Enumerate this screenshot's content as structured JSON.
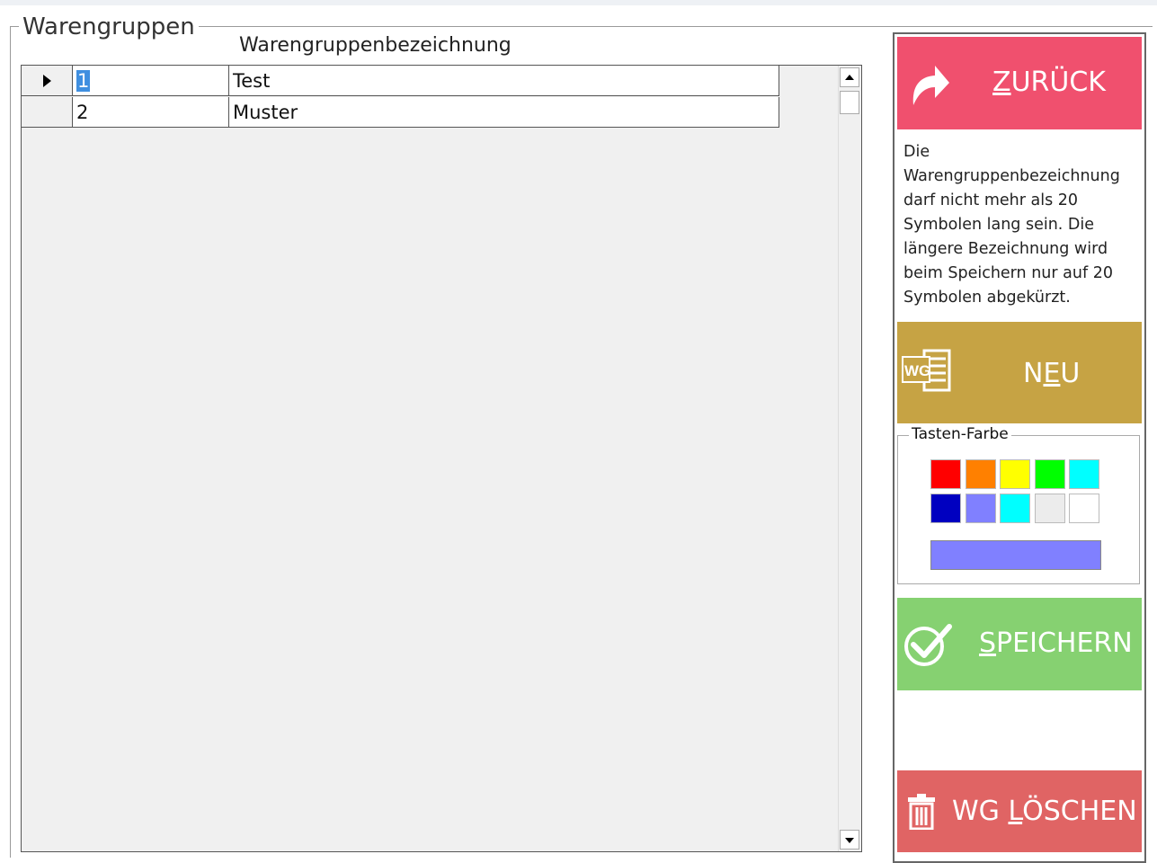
{
  "group_title": "Warengruppen",
  "grid": {
    "column_header": "Warengruppenbezeichnung",
    "rows": [
      {
        "id": "1",
        "name": "Test",
        "current": true
      },
      {
        "id": "2",
        "name": "Muster",
        "current": false
      }
    ]
  },
  "buttons": {
    "back": {
      "prefix": "",
      "underline": "Z",
      "rest": "URÜCK",
      "color": "#f0506e"
    },
    "new": {
      "prefix": "N",
      "underline": "E",
      "rest": "U",
      "icon_text": "WG",
      "color": "#c6a344"
    },
    "save": {
      "prefix": "",
      "underline": "S",
      "rest": "PEICHERN",
      "color": "#86d171"
    },
    "delete": {
      "prefix": "WG ",
      "underline": "L",
      "rest": "ÖSCHEN",
      "color": "#e06464"
    }
  },
  "info_text": "Die Warengruppenbezeichnung darf nicht mehr als 20 Symbolen lang sein.  Die längere Bezeichnung wird beim Speichern nur auf 20 Symbolen abgekürzt.",
  "color_picker": {
    "title": "Tasten-Farbe",
    "swatches": [
      "#ff0000",
      "#ff8000",
      "#ffff00",
      "#00ff00",
      "#00ffff",
      "#0000c0",
      "#8080ff",
      "#00ffff",
      "#ececec",
      "#ffffff"
    ],
    "selected_color": "#8080ff"
  },
  "icons": {
    "back": "share-arrow-icon",
    "new": "wg-document-icon",
    "save": "checkmark-icon",
    "delete": "trash-icon"
  }
}
